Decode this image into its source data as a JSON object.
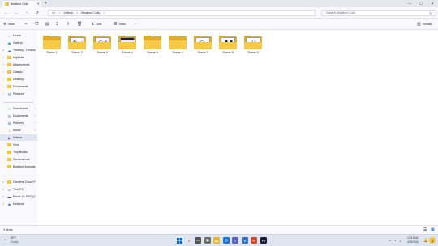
{
  "window": {
    "tab_title": "Beatbox Cuts",
    "new_tab": "+",
    "minimize": "—",
    "maximize": "☐",
    "close": "✕"
  },
  "nav": {
    "back": "←",
    "forward": "→",
    "up": "↑",
    "refresh": "⟳",
    "breadcrumb": [
      "Videos",
      "Beatbox Cuts"
    ],
    "separator": ">",
    "search_placeholder": "Search Beatbox Cuts"
  },
  "toolbar": {
    "new_label": "New",
    "sort_label": "Sort",
    "view_label": "View",
    "more": "···",
    "details_label": "Details"
  },
  "sidebar": {
    "top": [
      {
        "label": "Home",
        "icon": "home-icon",
        "glyph": "⌂",
        "color": "#d9682b"
      },
      {
        "label": "Gallery",
        "icon": "gallery-icon",
        "glyph": "▣",
        "color": "#2d8cd6"
      }
    ],
    "onedrive": {
      "label": "Timothy - Personal",
      "icon": "cloud-icon",
      "glyph": "☁",
      "color": "#1e73d8"
    },
    "onedrive_items": [
      {
        "label": "AppData",
        "icon": "folder-icon"
      },
      {
        "label": "Attachments",
        "icon": "folder-icon"
      },
      {
        "label": "Classic",
        "icon": "folder-icon"
      },
      {
        "label": "Desktop",
        "icon": "folder-icon"
      },
      {
        "label": "Documents",
        "icon": "folder-icon"
      },
      {
        "label": "Pictures",
        "icon": "pictures-icon"
      }
    ],
    "quick": [
      {
        "label": "Downloads",
        "icon": "downloads-icon",
        "glyph": "↓",
        "color": "#2a8a3e"
      },
      {
        "label": "Documents",
        "icon": "documents-icon",
        "glyph": "▤",
        "color": "#4a6fd8"
      },
      {
        "label": "Pictures",
        "icon": "pictures-icon",
        "glyph": "▨",
        "color": "#2d8cd6"
      },
      {
        "label": "Music",
        "icon": "music-icon",
        "glyph": "♪",
        "color": "#d8473a"
      },
      {
        "label": "Videos",
        "icon": "videos-icon",
        "glyph": "▶",
        "color": "#7a4bd0"
      },
      {
        "label": "Vivid",
        "icon": "folder-icon"
      },
      {
        "label": "Tiny Books",
        "icon": "folder-icon"
      },
      {
        "label": "Screenshots",
        "icon": "folder-icon"
      },
      {
        "label": "Beatbox Animals 1",
        "icon": "folder-icon"
      }
    ],
    "bottom": [
      {
        "label": "Creative Cloud Files",
        "icon": "folder-icon",
        "chev": ">"
      },
      {
        "label": "This PC",
        "icon": "pc-icon",
        "glyph": "▭",
        "color": "#2d6cc8",
        "chev": "v"
      },
      {
        "label": "Blade 15 SSD (C:)",
        "icon": "drive-icon",
        "glyph": "▬",
        "color": "#555",
        "chev": ">"
      },
      {
        "label": "Network",
        "icon": "network-icon",
        "glyph": "◉",
        "color": "#2d6cc8",
        "chev": ">"
      }
    ],
    "pin": "⊣"
  },
  "folders": [
    {
      "label": "Scene 1",
      "thumb": "blank"
    },
    {
      "label": "Scene 2",
      "thumb": "sketch"
    },
    {
      "label": "Scene 3",
      "thumb": "sketch"
    },
    {
      "label": "Scene 4",
      "thumb": "dark"
    },
    {
      "label": "Scene 5",
      "thumb": "blank"
    },
    {
      "label": "Scene 6",
      "thumb": "blank"
    },
    {
      "label": "Scene 7",
      "thumb": "sketch"
    },
    {
      "label": "Scene 8",
      "thumb": "eyes"
    },
    {
      "label": "Scene 9",
      "thumb": "sketch"
    }
  ],
  "status": {
    "items": "9 items"
  },
  "taskbar": {
    "weather_temp": "59°F",
    "weather_desc": "Cloudy",
    "time": "10:51 AM",
    "date": "4/26/2024",
    "colors": {
      "accent": "#0067c0"
    }
  }
}
